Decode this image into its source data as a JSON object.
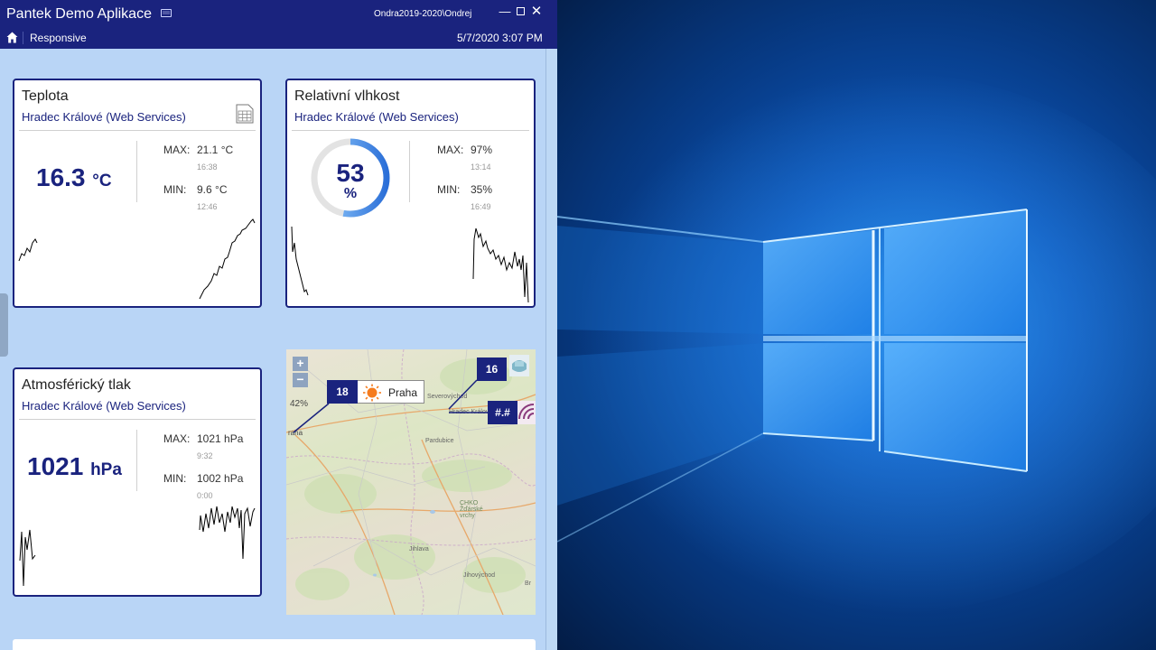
{
  "app": {
    "title": "Pantek Demo Aplikace",
    "user": "Ondra2019-2020\\Ondrej",
    "minimize_glyph": "—",
    "close_glyph": "✕"
  },
  "nav": {
    "home_icon": "home-icon",
    "section": "Responsive",
    "datetime": "5/7/2020 3:07 PM"
  },
  "cards": {
    "temperature": {
      "title": "Teplota",
      "subtitle": "Hradec Králové (Web Services)",
      "value": "16.3",
      "unit": "°C",
      "max_label": "MAX:",
      "max_value": "21.1 °C",
      "max_time": "16:38",
      "min_label": "MIN:",
      "min_value": "9.6 °C",
      "min_time": "12:46",
      "icon": "table-icon"
    },
    "humidity": {
      "title": "Relativní vlhkost",
      "subtitle": "Hradec Králové (Web Services)",
      "value": "53",
      "unit": "%",
      "gauge_fraction": 0.53,
      "max_label": "MAX:",
      "max_value": "97%",
      "max_time": "13:14",
      "min_label": "MIN:",
      "min_value": "35%",
      "min_time": "16:49"
    },
    "pressure": {
      "title": "Atmosférický tlak",
      "subtitle": "Hradec Králové (Web Services)",
      "value": "1021",
      "unit": "hPa",
      "max_label": "MAX:",
      "max_value": "1021 hPa",
      "max_time": "9:32",
      "min_label": "MIN:",
      "min_value": "1002 hPa",
      "min_time": "0:00"
    }
  },
  "map": {
    "zoom_in": "+",
    "zoom_out": "−",
    "pct": "42%",
    "praha_value": "18",
    "praha_label": "Praha",
    "hk_value": "16",
    "third_value": "#.#",
    "labels": {
      "severovychod": "Severovýchod",
      "hradec": "Hradec Králové",
      "pardubice": "Pardubice",
      "praha_edge": "raha",
      "chko": "CHKO Žďárské vrchy",
      "jihlava": "Jihlava",
      "jihovychod": "Jihovýchod",
      "brno_edge": "Br"
    }
  },
  "colors": {
    "accent": "#1a237e",
    "window_bg": "#b9d5f6",
    "gauge": "#2b6fd8"
  }
}
